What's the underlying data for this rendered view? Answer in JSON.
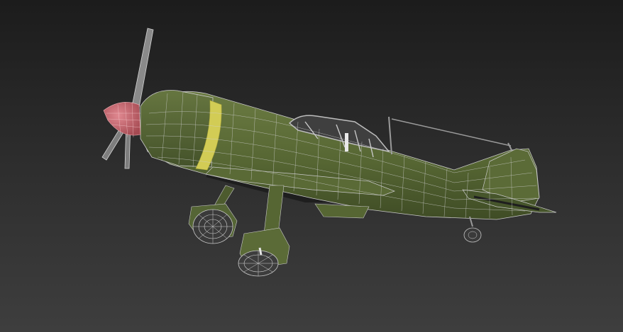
{
  "viewport": {
    "background_top": "#1c1c1c",
    "background_bottom": "#3e3e3e",
    "display_mode": "wireframe-over-shaded",
    "wire_color": "#c9c9c9"
  },
  "model": {
    "subject": "single-engine-propeller-fighter",
    "body_color": "#5a6a36",
    "band_color": "#d2cc55",
    "spinner_color": "#c8606a",
    "metal_color": "#8a8a8a",
    "shadow_color": "#1e1e1e"
  }
}
